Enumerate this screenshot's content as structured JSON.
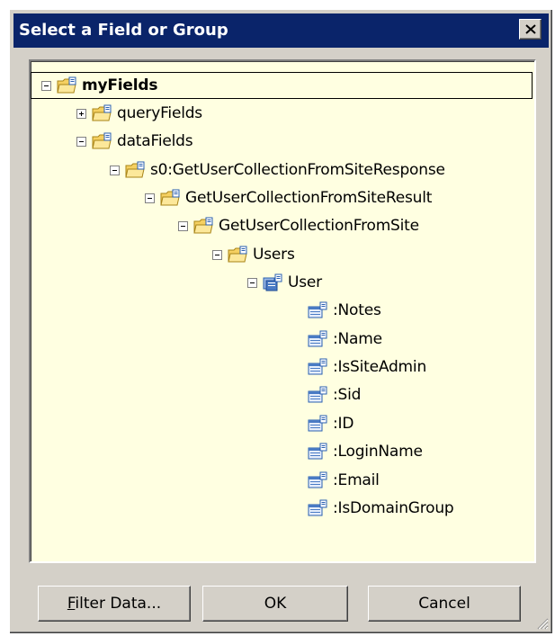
{
  "dialog": {
    "title": "Select a Field or Group"
  },
  "tree": {
    "nodes": [
      {
        "label": "myFields",
        "expander": "minus",
        "icon": "folder-icon",
        "bold": true,
        "selected": true
      },
      {
        "label": "queryFields",
        "expander": "plus",
        "icon": "folder-icon"
      },
      {
        "label": "dataFields",
        "expander": "minus",
        "icon": "folder-icon"
      },
      {
        "label": "s0:GetUserCollectionFromSiteResponse",
        "expander": "minus",
        "icon": "folder-icon"
      },
      {
        "label": "GetUserCollectionFromSiteResult",
        "expander": "minus",
        "icon": "folder-icon"
      },
      {
        "label": "GetUserCollectionFromSite",
        "expander": "minus",
        "icon": "folder-icon"
      },
      {
        "label": "Users",
        "expander": "minus",
        "icon": "folder-icon"
      },
      {
        "label": "User",
        "expander": "minus",
        "icon": "repeating-group-icon"
      },
      {
        "label": ":Notes",
        "expander": "none",
        "icon": "attribute-field-icon"
      },
      {
        "label": ":Name",
        "expander": "none",
        "icon": "attribute-field-icon"
      },
      {
        "label": ":IsSiteAdmin",
        "expander": "none",
        "icon": "attribute-field-icon"
      },
      {
        "label": ":Sid",
        "expander": "none",
        "icon": "attribute-field-icon"
      },
      {
        "label": ":ID",
        "expander": "none",
        "icon": "attribute-field-icon"
      },
      {
        "label": ":LoginName",
        "expander": "none",
        "icon": "attribute-field-icon"
      },
      {
        "label": ":Email",
        "expander": "none",
        "icon": "attribute-field-icon"
      },
      {
        "label": ":IsDomainGroup",
        "expander": "none",
        "icon": "attribute-field-icon"
      }
    ]
  },
  "buttons": {
    "filter_data": {
      "accel": "F",
      "rest": "ilter Data..."
    },
    "ok": "OK",
    "cancel": "Cancel"
  },
  "colors": {
    "title_bar": "#0a246a",
    "tree_background": "#ffffe1",
    "dialog_face": "#d4d0c8",
    "folder": "#f5d061",
    "field_icon": "#4a7bc4"
  }
}
